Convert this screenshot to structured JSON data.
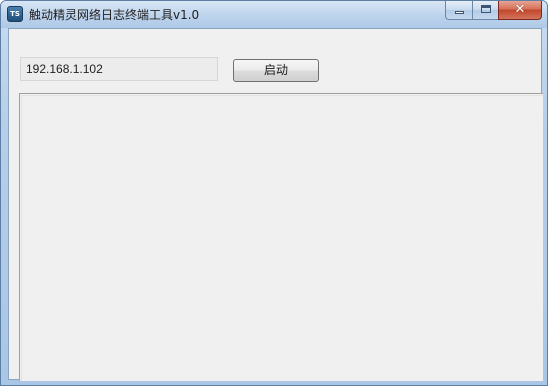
{
  "window": {
    "title": "触动精灵网络日志终端工具v1.0",
    "icon_name": "app-icon",
    "icon_glyph": "TS",
    "minimize_glyph": "minimize-icon",
    "maximize_glyph": "maximize-icon",
    "close_glyph": "✕"
  },
  "form": {
    "ip_value": "192.168.1.102",
    "start_label": "启动"
  },
  "log": {
    "content": ""
  },
  "colors": {
    "titlebar": "#bdd3ec",
    "client_bg": "#f0f0f0",
    "close_button": "#c2462a"
  }
}
